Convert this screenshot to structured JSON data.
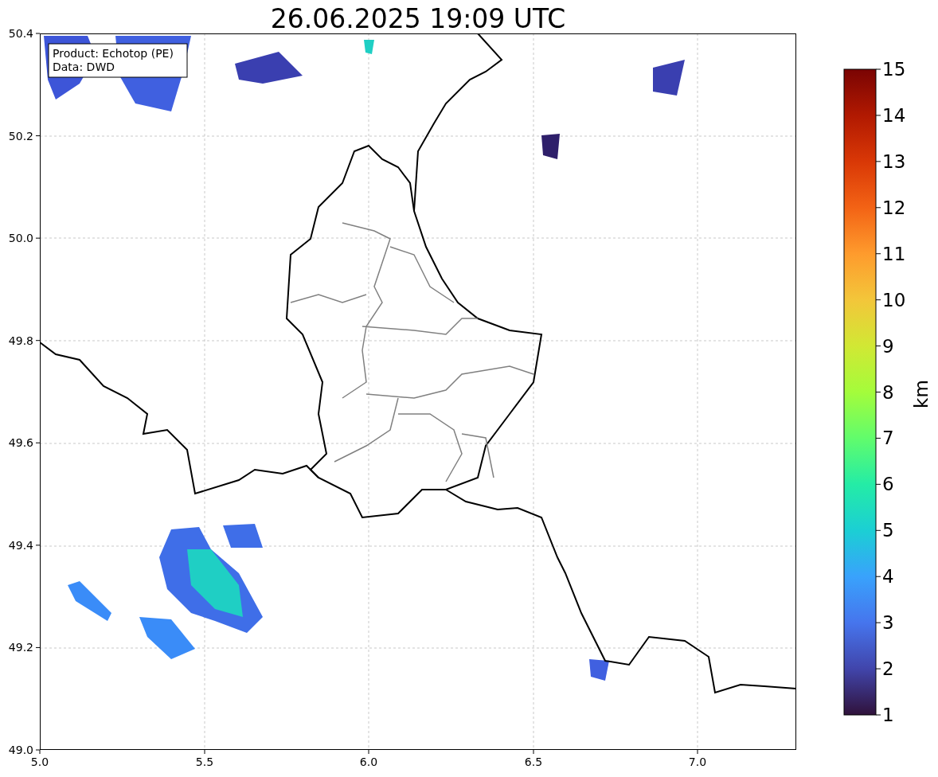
{
  "title": "26.06.2025 19:09 UTC",
  "info_box": [
    "Product: Echotop (PE)",
    "Data: DWD"
  ],
  "x_ticks": [
    "5.0",
    "5.5",
    "6.0",
    "6.5",
    "7.0"
  ],
  "y_ticks": [
    "50.4",
    "50.2",
    "50.0",
    "49.8",
    "49.6",
    "49.4",
    "49.2",
    "49.0"
  ],
  "colorbar": {
    "label": "km",
    "ticks": [
      "15",
      "14",
      "13",
      "12",
      "11",
      "10",
      "9",
      "8",
      "7",
      "6",
      "5",
      "4",
      "3",
      "2",
      "1"
    ]
  }
}
